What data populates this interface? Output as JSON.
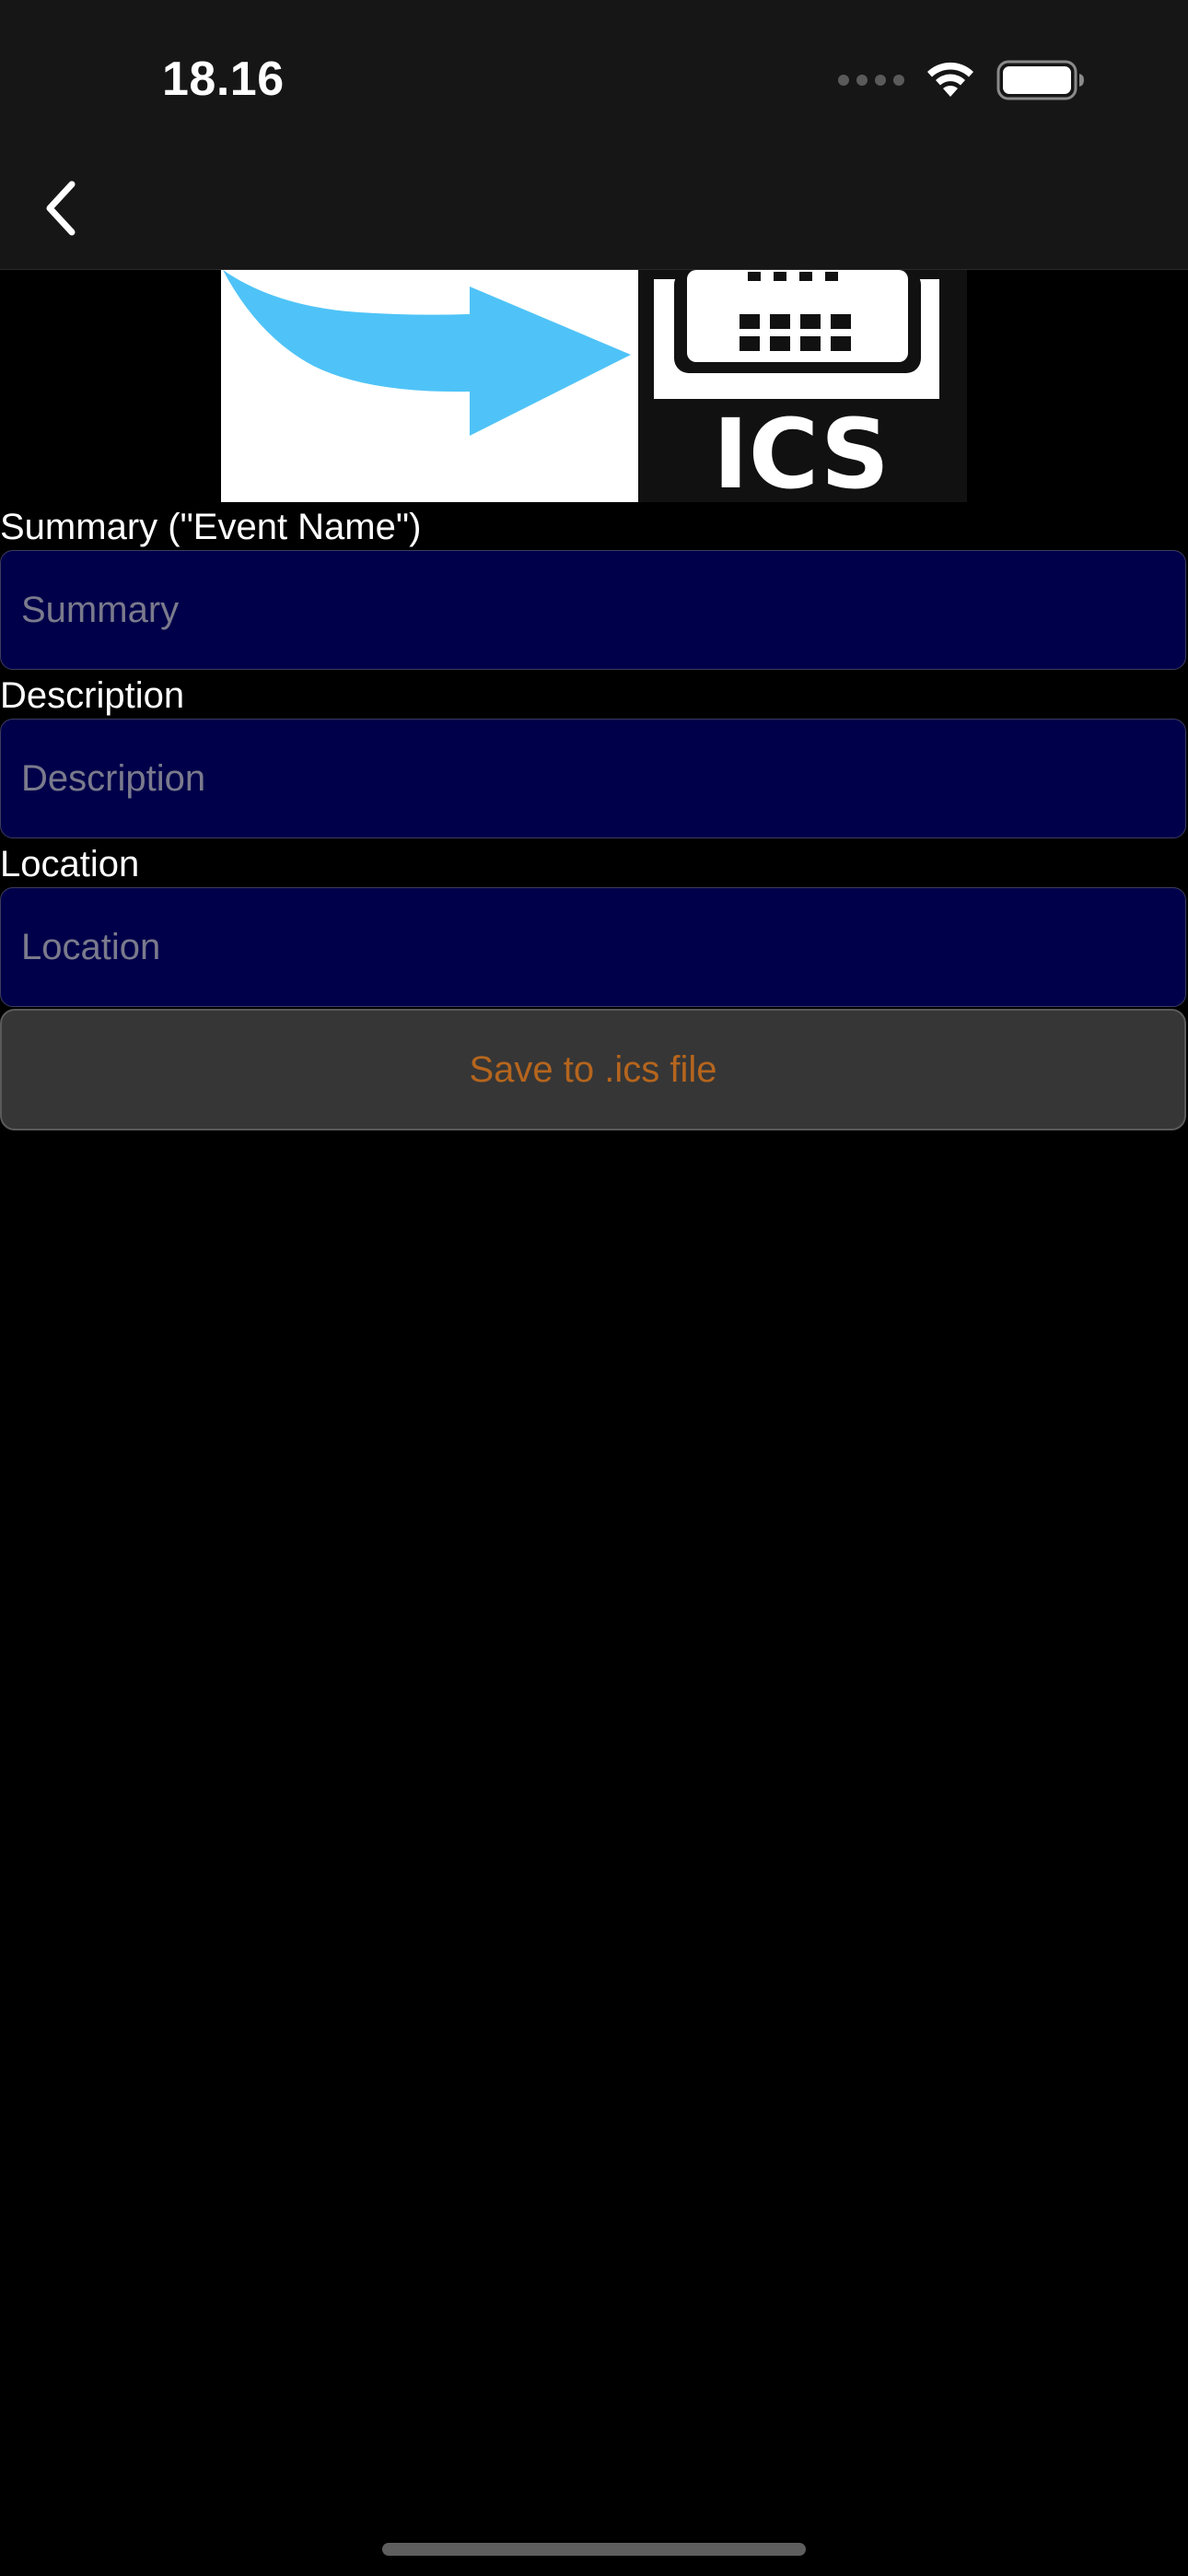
{
  "status_bar": {
    "time": "18.16",
    "icons": [
      "cellular-signal-icon",
      "wifi-icon",
      "battery-icon"
    ]
  },
  "nav_bar": {
    "back_icon": "chevron-left-icon"
  },
  "banner": {
    "arrow_color": "#4fc3f7",
    "text": "ICS"
  },
  "form": {
    "summary": {
      "label": "Summary (\"Event Name\")",
      "placeholder": "Summary",
      "value": ""
    },
    "description": {
      "label": "Description",
      "placeholder": "Description",
      "value": ""
    },
    "location": {
      "label": "Location",
      "placeholder": "Location",
      "value": ""
    },
    "save_label": "Save to .ics file"
  },
  "colors": {
    "background": "#000000",
    "bar_background": "#161616",
    "field_background": "#00004a",
    "button_background": "#363636",
    "button_text": "#b5651d"
  }
}
